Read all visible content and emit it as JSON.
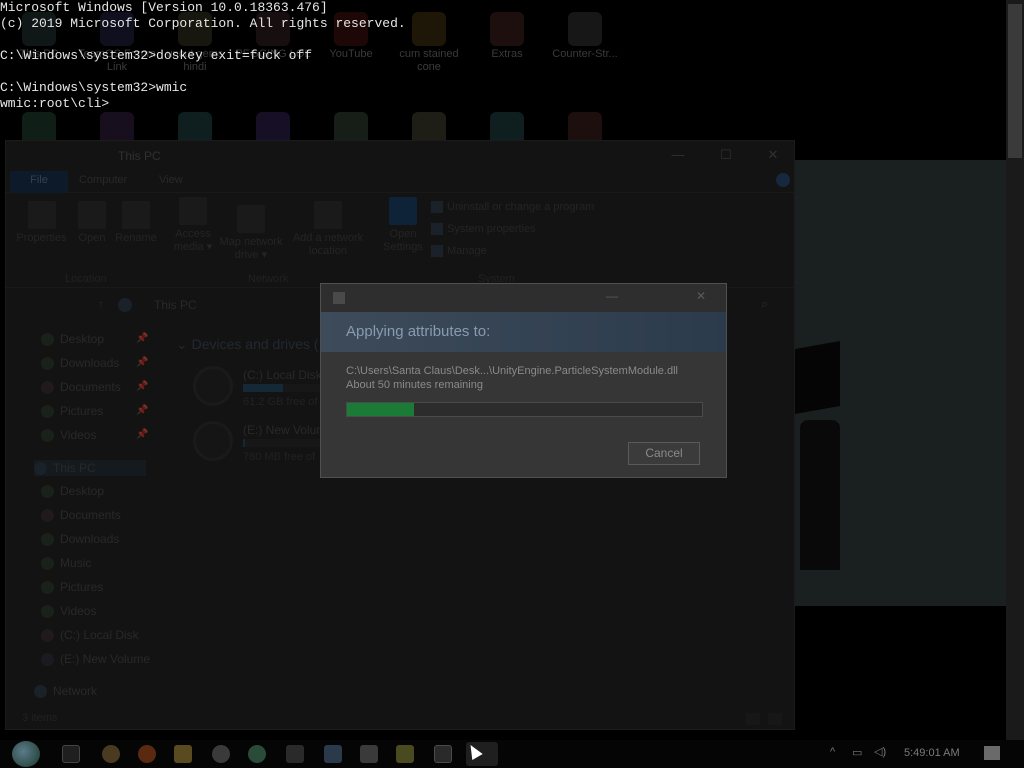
{
  "console": {
    "lines": [
      "Microsoft Windows [Version 10.0.18363.476]",
      "(c) 2019 Microsoft Corporation. All rights reserved.",
      "",
      "C:\\Windows\\system32>doskey exit=fuck off",
      "",
      "C:\\Windows\\system32>wmic",
      "wmic:root\\cli>"
    ]
  },
  "desktop": {
    "icons": [
      {
        "label": "This PC"
      },
      {
        "label": "TeamOS Forum Link"
      },
      {
        "label": "uncut gems hindi"
      },
      {
        "label": "PEGGING LOL"
      },
      {
        "label": "YouTube"
      },
      {
        "label": "cum stained cone"
      },
      {
        "label": "Extras"
      },
      {
        "label": "Counter-Str..."
      }
    ]
  },
  "explorer": {
    "title": "This PC",
    "tabs": [
      "File",
      "Computer",
      "View"
    ],
    "ribbon": {
      "buttons": [
        "Properties",
        "Open",
        "Rename",
        "Access media ▾",
        "Map network drive ▾",
        "Add a network location",
        "Open Settings"
      ],
      "links": [
        "Uninstall or change a program",
        "System properties",
        "Manage"
      ],
      "groups": [
        "Location",
        "Network",
        "System"
      ]
    },
    "address": "This PC",
    "nav": {
      "quick_access": [
        "Desktop",
        "Downloads",
        "Documents",
        "Pictures",
        "Videos"
      ],
      "this_pc_label": "This PC",
      "this_pc_children": [
        "Desktop",
        "Documents",
        "Downloads",
        "Music",
        "Pictures",
        "Videos",
        "(C:) Local Disk",
        "(E:) New Volume"
      ],
      "network_label": "Network"
    },
    "section_header": "Devices and drives (",
    "drives": [
      {
        "name": "(C:) Local Disk",
        "free": "61.2 GB free of",
        "used_fraction": 0.5
      },
      {
        "name": "(E:) New Volum",
        "free": "780 MB free of",
        "used_fraction": 0.03
      }
    ],
    "status": "3 items"
  },
  "dialog": {
    "heading": "Applying attributes to:",
    "path": "C:\\Users\\Santa Claus\\Desk...\\UnityEngine.ParticleSystemModule.dll",
    "time_remaining": "About 50 minutes remaining",
    "progress": 0.19,
    "cancel_label": "Cancel"
  },
  "taskbar": {
    "clock": "5:49:01 AM"
  },
  "colors": {
    "accent": "#1c3a5c",
    "progress": "#1b7a36"
  }
}
